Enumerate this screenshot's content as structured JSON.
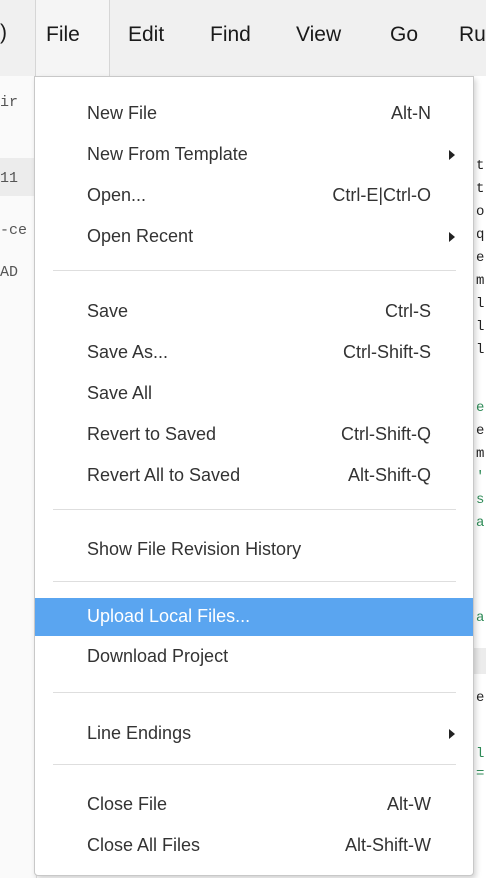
{
  "menubar": {
    "items": [
      {
        "label": "File"
      },
      {
        "label": "Edit"
      },
      {
        "label": "Find"
      },
      {
        "label": "View"
      },
      {
        "label": "Go"
      },
      {
        "label": "Ru"
      }
    ]
  },
  "background": {
    "left_panel_text": [
      "ir",
      "11",
      "-ce",
      "AD"
    ],
    "right_code_chars": [
      "t",
      "t",
      "o",
      "q",
      "e",
      "m",
      "l",
      "l",
      "l",
      "e",
      "e",
      "m",
      "'",
      "s",
      "a",
      "a",
      "e",
      "l",
      "="
    ]
  },
  "file_menu": {
    "items": [
      {
        "label": "New File",
        "shortcut": "Alt-N"
      },
      {
        "label": "New From Template",
        "shortcut": ""
      },
      {
        "label": "Open...",
        "shortcut": "Ctrl-E|Ctrl-O"
      },
      {
        "label": "Open Recent",
        "shortcut": ""
      },
      {
        "label": "Save",
        "shortcut": "Ctrl-S"
      },
      {
        "label": "Save As...",
        "shortcut": "Ctrl-Shift-S"
      },
      {
        "label": "Save All",
        "shortcut": ""
      },
      {
        "label": "Revert to Saved",
        "shortcut": "Ctrl-Shift-Q"
      },
      {
        "label": "Revert All to Saved",
        "shortcut": "Alt-Shift-Q"
      },
      {
        "label": "Show File Revision History",
        "shortcut": ""
      },
      {
        "label": "Upload Local Files...",
        "shortcut": ""
      },
      {
        "label": "Download Project",
        "shortcut": ""
      },
      {
        "label": "Line Endings",
        "shortcut": ""
      },
      {
        "label": "Close File",
        "shortcut": "Alt-W"
      },
      {
        "label": "Close All Files",
        "shortcut": "Alt-Shift-W"
      }
    ],
    "highlighted_item": "Upload Local Files..."
  },
  "colors": {
    "highlight": "#5aa5f0",
    "menubar_bg": "#f0f0f0"
  }
}
